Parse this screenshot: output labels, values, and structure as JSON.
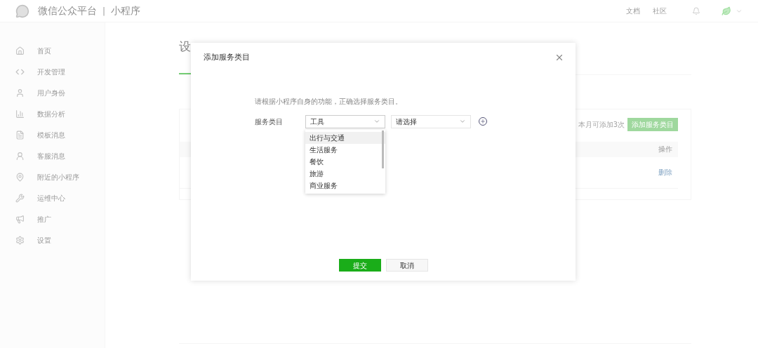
{
  "header": {
    "title": "微信公众平台",
    "separator": "|",
    "subtitle": "小程序",
    "links": [
      "文档",
      "社区"
    ]
  },
  "sidebar": {
    "items": [
      {
        "label": "首页"
      },
      {
        "label": "开发管理"
      },
      {
        "label": "用户身份"
      },
      {
        "label": "数据分析"
      },
      {
        "label": "模板消息"
      },
      {
        "label": "客服消息"
      },
      {
        "label": "附近的小程序"
      },
      {
        "label": "运维中心"
      },
      {
        "label": "推广"
      },
      {
        "label": "设置"
      }
    ]
  },
  "page": {
    "title": "设",
    "card": {
      "quota_note": "本月可添加3次",
      "add_button": "添加服务类目",
      "table_header": "操作",
      "row_action": "删除"
    }
  },
  "dialog": {
    "title": "添加服务类目",
    "hint": "请根据小程序自身的功能，正确选择服务类目。",
    "field_label": "服务类目",
    "selects": [
      {
        "value": "工具",
        "open": true
      },
      {
        "value": "请选择",
        "open": false
      }
    ],
    "dropdown": [
      {
        "label": "出行与交通",
        "selected": true
      },
      {
        "label": "生活服务",
        "selected": false
      },
      {
        "label": "餐饮",
        "selected": false
      },
      {
        "label": "旅游",
        "selected": false
      },
      {
        "label": "商业服务",
        "selected": false
      }
    ],
    "buttons": [
      {
        "label": "提交",
        "kind": "primary"
      },
      {
        "label": "取消",
        "kind": "default"
      }
    ]
  }
}
